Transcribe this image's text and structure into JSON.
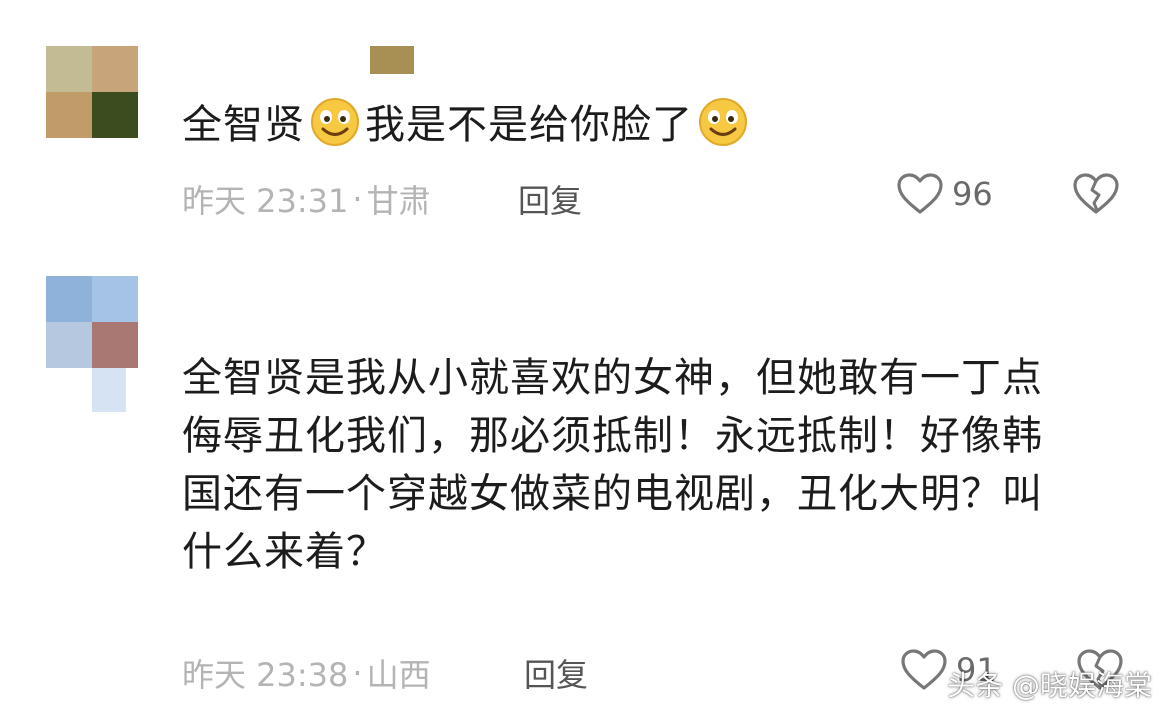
{
  "comments": [
    {
      "segments": [
        "全智贤",
        "我是不是给你脸了"
      ],
      "emoji": [
        "smile-emoji",
        "smile-emoji"
      ],
      "time": "昨天 23:31",
      "location": "甘肃",
      "reply_label": "回复",
      "likes": "96"
    },
    {
      "text": "全智贤是我从小就喜欢的女神，但她敢有一丁点\n侮辱丑化我们，那必须抵制！永远抵制！好像韩\n国还有一个穿越女做菜的电视剧，丑化大明？叫\n什么来着？",
      "time": "昨天 23:38",
      "location": "山西",
      "reply_label": "回复",
      "likes": "91"
    }
  ],
  "separator": "·",
  "icons": {
    "like": "heart-outline-icon",
    "dislike": "broken-heart-icon"
  },
  "watermark": "头条 @晓娱海棠",
  "colors": {
    "meta": "#b4b4b4",
    "text": "#1c1c1c",
    "emoji": "#f7c842"
  }
}
